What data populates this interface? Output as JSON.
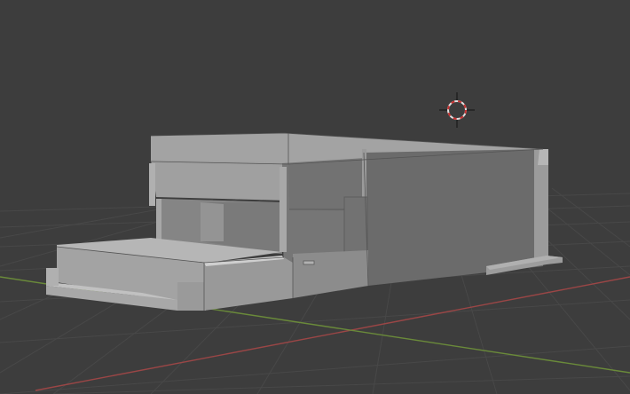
{
  "viewport": {
    "mode": "3D Viewport",
    "background": "#3d3d3d",
    "grid_color": "#4a4a4a",
    "x_axis_color": "#a24a4a",
    "y_axis_color": "#6e8f3c"
  },
  "scene": {
    "object": "truck-body-mesh",
    "mesh_colors": {
      "top": "#a3a3a3",
      "front": "#9b9b9b",
      "side": "#6c6c6c",
      "dark_side": "#5f5f5f",
      "light": "#b4b4b4",
      "edge": "#4a4a4a"
    },
    "cursor": {
      "icon": "3d-cursor-icon",
      "ring_color": "#d8d8d8",
      "dash_color": "#c83232"
    }
  }
}
